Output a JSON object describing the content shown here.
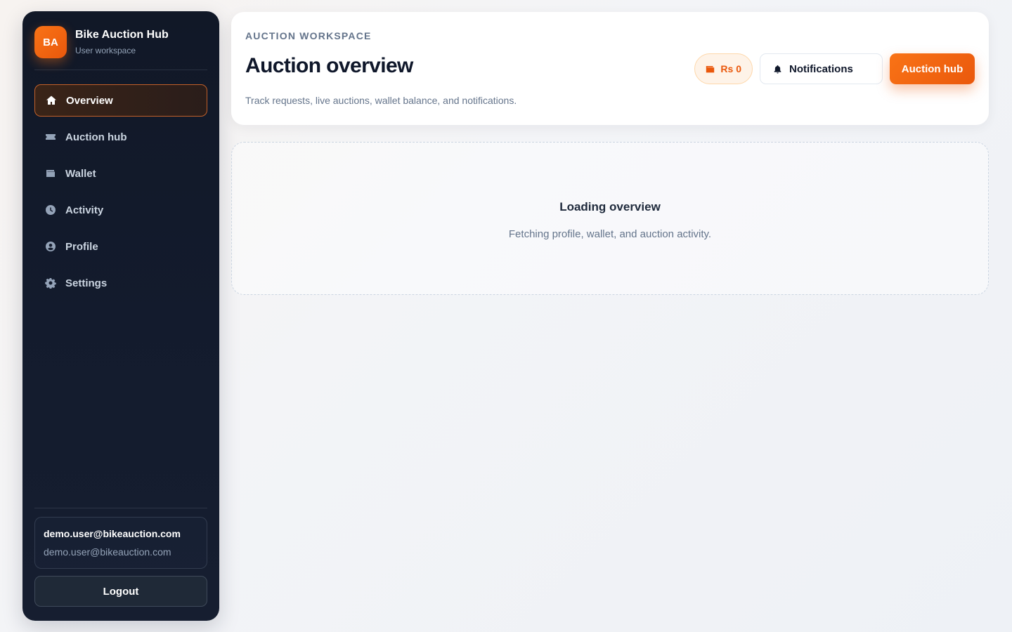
{
  "sidebar": {
    "brand": {
      "initials": "BA",
      "title": "Bike Auction Hub",
      "subtitle": "User workspace"
    },
    "items": [
      {
        "label": "Overview",
        "icon": "home-icon",
        "active": true
      },
      {
        "label": "Auction hub",
        "icon": "ticket-icon",
        "active": false
      },
      {
        "label": "Wallet",
        "icon": "wallet-icon",
        "active": false
      },
      {
        "label": "Activity",
        "icon": "clock-icon",
        "active": false
      },
      {
        "label": "Profile",
        "icon": "user-circle-icon",
        "active": false
      },
      {
        "label": "Settings",
        "icon": "gear-icon",
        "active": false
      }
    ],
    "user": {
      "name": "demo.user@bikeauction.com",
      "email": "demo.user@bikeauction.com"
    },
    "logout_label": "Logout"
  },
  "header": {
    "eyebrow": "AUCTION WORKSPACE",
    "title": "Auction overview",
    "description": "Track requests, live auctions, wallet balance, and notifications.",
    "wallet_balance": "Rs 0",
    "notifications_label": "Notifications",
    "auction_hub_label": "Auction hub"
  },
  "loading": {
    "title": "Loading overview",
    "subtitle": "Fetching profile, wallet, and auction activity."
  },
  "colors": {
    "accent": "#f97316",
    "sidebar_bg": "#111827",
    "active_border": "#c2602a"
  }
}
